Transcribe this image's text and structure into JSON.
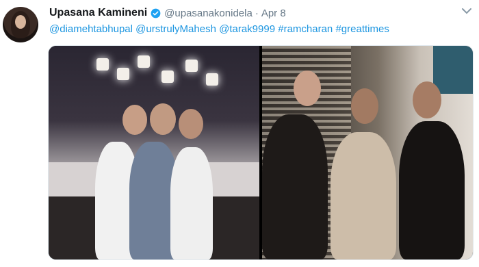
{
  "tweet": {
    "name": "Upasana Kamineni",
    "handle": "@upasanakonidela",
    "separator": "·",
    "date": "Apr 8",
    "text_parts": [
      "@diamehtabhupal",
      " ",
      "@urstrulyMahesh",
      " ",
      "@tarak9999",
      " ",
      "#ramcharan",
      " ",
      "#greattimes"
    ]
  },
  "icons": {
    "verified": "verified-badge-icon",
    "caret": "chevron-down-icon"
  },
  "colors": {
    "link": "#1b95e0",
    "name": "#14171a",
    "muted": "#657786",
    "verified": "#1da1f2"
  },
  "media": {
    "count": 2
  }
}
